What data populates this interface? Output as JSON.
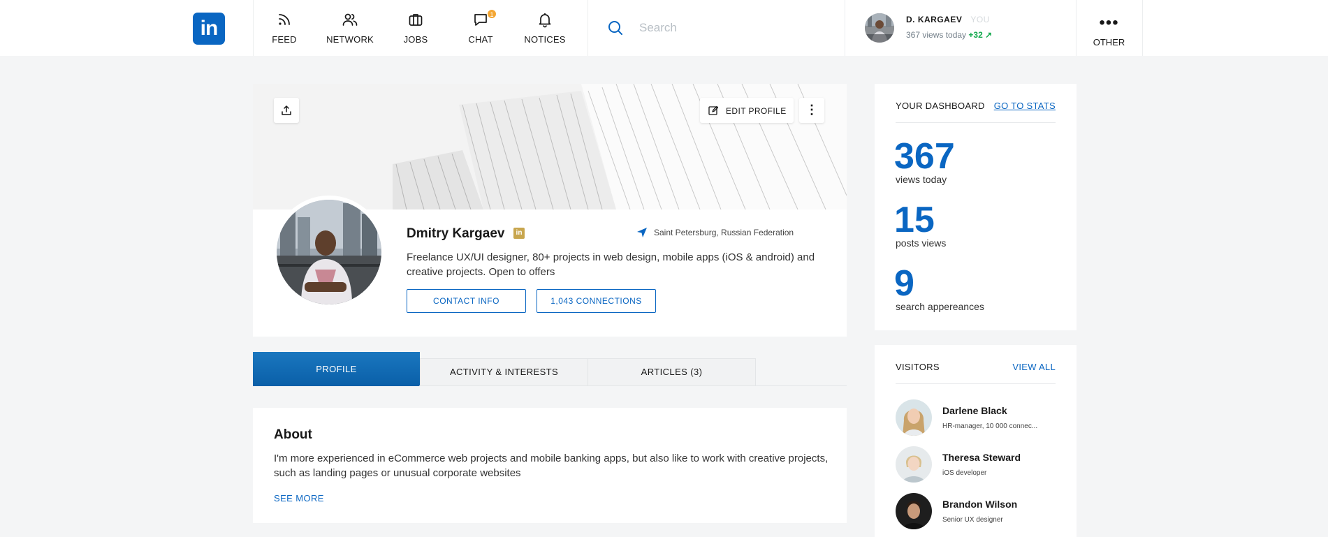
{
  "nav": {
    "logo": "in",
    "items": [
      {
        "label": "FEED",
        "icon": "rss-icon"
      },
      {
        "label": "NETWORK",
        "icon": "network-icon"
      },
      {
        "label": "JOBS",
        "icon": "briefcase-icon"
      },
      {
        "label": "CHAT",
        "icon": "chat-icon",
        "badge": "1"
      },
      {
        "label": "NOTICES",
        "icon": "bell-icon"
      }
    ],
    "search_placeholder": "Search",
    "me": {
      "name": "D. KARGAEV",
      "you": "YOU",
      "views": "367 views today",
      "delta": "+32 ↗"
    },
    "other": {
      "label": "OTHER",
      "dots": "•••"
    }
  },
  "profile": {
    "edit_label": "EDIT PROFILE",
    "more_label": "⋮",
    "name": "Dmitry Kargaev",
    "badge": "in",
    "location": "Saint Petersburg, Russian Federation",
    "headline": "Freelance UX/UI designer, 80+ projects in web design, mobile apps (iOS & android) and creative projects. Open to offers",
    "contact_label": "CONTACT INFO",
    "connections_label": "1,043 CONNECTIONS"
  },
  "tabs": [
    {
      "label": "PROFILE",
      "active": true
    },
    {
      "label": "ACTIVITY & INTERESTS",
      "active": false
    },
    {
      "label": "ARTICLES  (3)",
      "active": false
    }
  ],
  "about": {
    "title": "About",
    "text": "I'm more experienced in eCommerce web projects and mobile banking apps, but also like to work with creative projects, such as landing pages or unusual corporate websites",
    "see_more": "SEE MORE"
  },
  "dashboard": {
    "title": "YOUR DASHBOARD",
    "link": "GO TO STATS",
    "stats": [
      {
        "value": "367",
        "label": "views today"
      },
      {
        "value": "15",
        "label": "posts views"
      },
      {
        "value": "9",
        "label": "search appereances"
      }
    ]
  },
  "visitors": {
    "title": "VISITORS",
    "link": "VIEW ALL",
    "items": [
      {
        "name": "Darlene Black",
        "role": "HR-manager, 10 000 connec..."
      },
      {
        "name": "Theresa Steward",
        "role": "iOS developer"
      },
      {
        "name": "Brandon Wilson",
        "role": "Senior UX designer"
      }
    ]
  },
  "colors": {
    "accent": "#0a66c2",
    "badge": "#f4a633",
    "positive": "#14a94e",
    "gold": "#c8a64e"
  }
}
